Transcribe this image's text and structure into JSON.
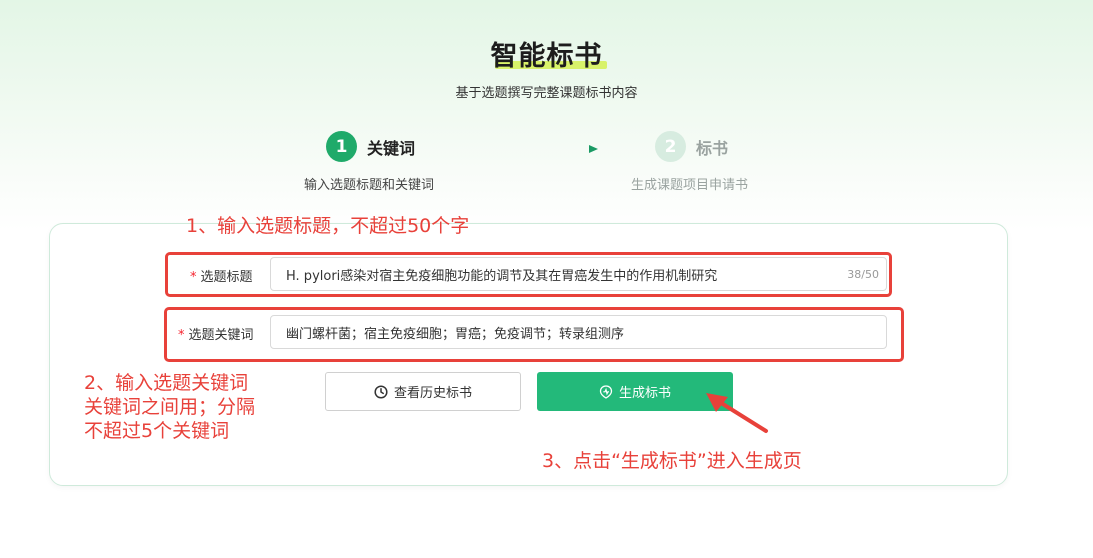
{
  "header": {
    "title": "智能标书",
    "subtitle": "基于选题撰写完整课题标书内容"
  },
  "steps": [
    {
      "number": "1",
      "label": "关键词",
      "description": "输入选题标题和关键词",
      "active": true
    },
    {
      "number": "2",
      "label": "标书",
      "description": "生成课题项目申请书",
      "active": false
    }
  ],
  "form": {
    "title_field": {
      "required_mark": "*",
      "label": "选题标题",
      "value": "H. pylori感染对宿主免疫细胞功能的调节及其在胃癌发生中的作用机制研究",
      "counter": "38/50"
    },
    "keywords_field": {
      "required_mark": "*",
      "label": "选题关键词",
      "value": "幽门螺杆菌；宿主免疫细胞；胃癌；免疫调节；转录组测序"
    }
  },
  "buttons": {
    "history_label": "查看历史标书",
    "history_icon": "clock-icon",
    "generate_label": "生成标书",
    "generate_icon": "spark-icon"
  },
  "annotations": {
    "note_1": "1、输入选题标题，不超过50个字",
    "note_2_lines": [
      "2、输入选题关键词",
      "关键词之间用；分隔",
      "不超过5个关键词"
    ],
    "note_3": "3、点击“生成标书”进入生成页"
  },
  "colors": {
    "brand_green": "#23b97a",
    "step_active": "#1faa6a",
    "step_inactive": "#d7ece0",
    "annotation_red": "#e8413a",
    "required_red": "#f5222d"
  }
}
